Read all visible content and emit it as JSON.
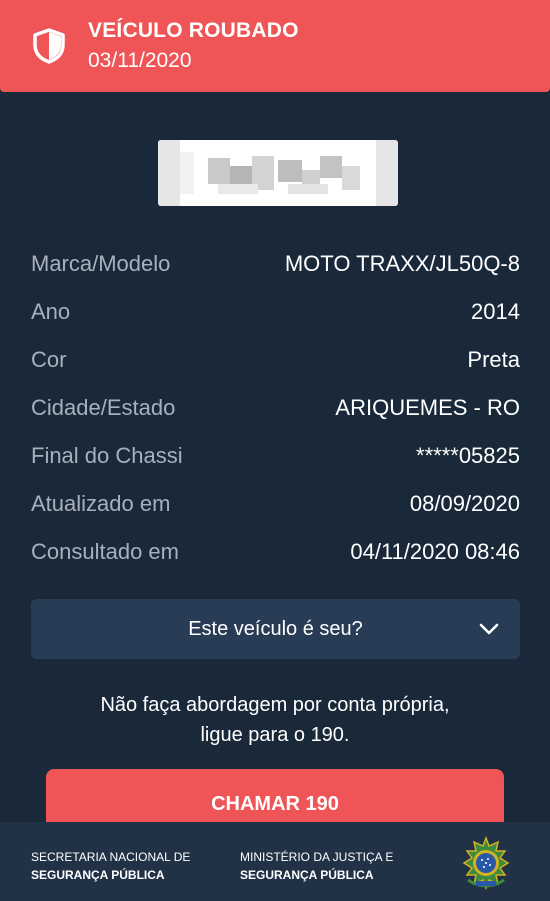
{
  "alert": {
    "title": "VEÍCULO ROUBADO",
    "date": "03/11/2020",
    "icon": "shield-icon",
    "color": "#ef5556"
  },
  "vehicle": {
    "rows": [
      {
        "label": "Marca/Modelo",
        "value": "MOTO TRAXX/JL50Q-8"
      },
      {
        "label": "Ano",
        "value": "2014"
      },
      {
        "label": "Cor",
        "value": "Preta"
      },
      {
        "label": "Cidade/Estado",
        "value": "ARIQUEMES - RO"
      },
      {
        "label": "Final do Chassi",
        "value": "*****05825"
      },
      {
        "label": "Atualizado em",
        "value": "08/09/2020"
      },
      {
        "label": "Consultado em",
        "value": "04/11/2020 08:46"
      }
    ]
  },
  "owner_toggle": {
    "label": "Este veículo é seu?",
    "icon": "chevron-down-icon"
  },
  "warning": {
    "line1": "Não faça abordagem por conta própria,",
    "line2": "ligue para o 190."
  },
  "call_button": {
    "label": "CHAMAR 190"
  },
  "footer": {
    "org1": {
      "line1": "SECRETARIA NACIONAL DE",
      "line2": "SEGURANÇA PÚBLICA"
    },
    "org2": {
      "line1": "MINISTÉRIO DA JUSTIÇA E",
      "line2": "SEGURANÇA PÚBLICA"
    },
    "emblem": "brazil-coat-of-arms-icon"
  },
  "colors": {
    "background": "#19293a",
    "panel": "#283d55",
    "footer": "#213246",
    "label": "#a7b0bb"
  }
}
